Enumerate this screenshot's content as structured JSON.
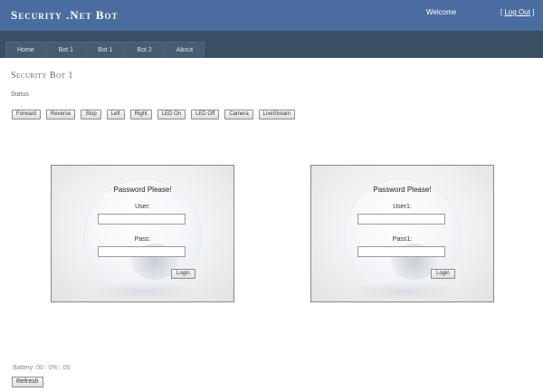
{
  "header": {
    "site_title": "Security .Net Bot",
    "welcome_text": "Welcome",
    "logout_open": "[ ",
    "logout_label": "Log Out",
    "logout_close": " ]"
  },
  "menu": {
    "items": [
      {
        "label": "Home"
      },
      {
        "label": "Bot 1"
      },
      {
        "label": "Bot 1"
      },
      {
        "label": "Bot 2"
      },
      {
        "label": "About"
      }
    ]
  },
  "main": {
    "page_title": "Security Bot 1",
    "status_label": "Status",
    "controls": [
      {
        "label": "Forward"
      },
      {
        "label": "Reverse"
      },
      {
        "label": "Stop"
      },
      {
        "label": "Left"
      },
      {
        "label": "Right"
      },
      {
        "label": "LED On"
      },
      {
        "label": "LED Off"
      },
      {
        "label": "Camera"
      },
      {
        "label": "LiveStream"
      }
    ]
  },
  "login_left": {
    "title": "Password Please!",
    "user_label": "User:",
    "pass_label": "Pass:",
    "button_label": "Login"
  },
  "login_right": {
    "title": "Password Please!",
    "user_label": "User1:",
    "pass_label": "Pass1:",
    "button_label": "Login"
  },
  "footer": {
    "battery_text": "Battery: 00 : 0% : 00",
    "refresh_label": "Refresh"
  }
}
